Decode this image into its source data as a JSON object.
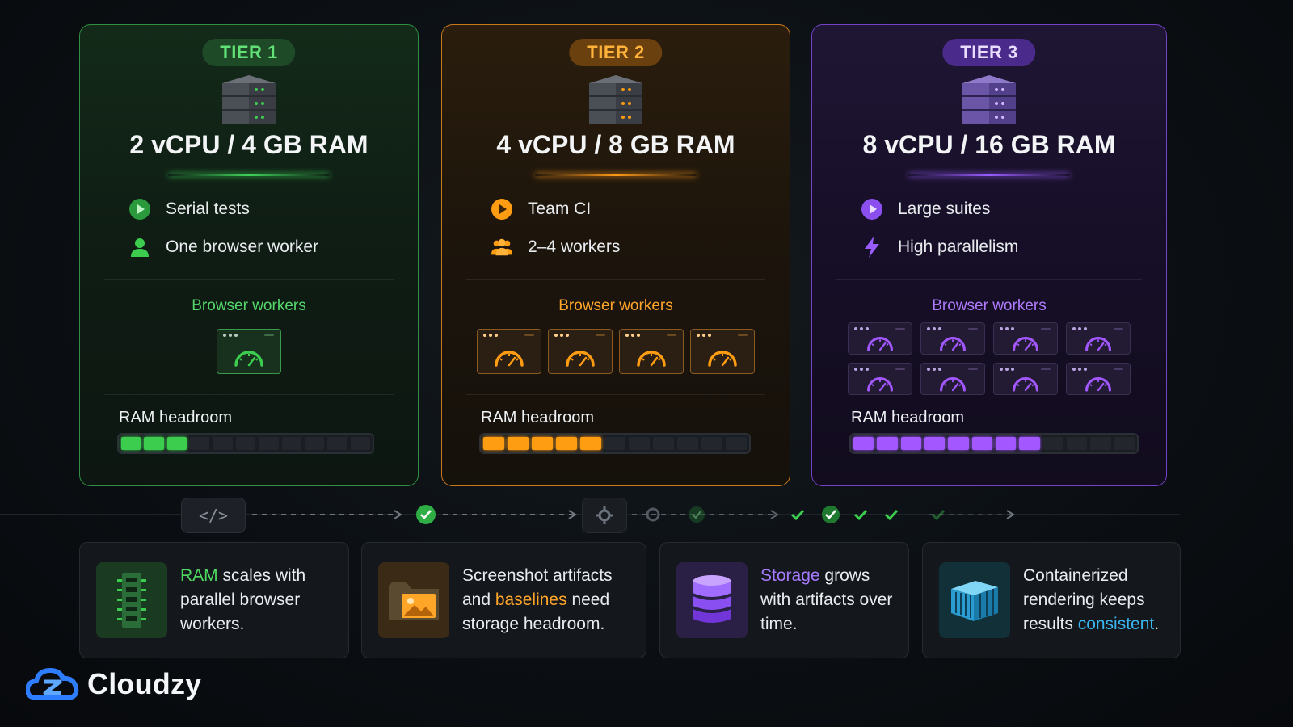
{
  "tiers": [
    {
      "badge": "TIER 1",
      "spec": "2 vCPU / 4 GB RAM",
      "features": [
        "Serial tests",
        "One browser worker"
      ],
      "workers_label": "Browser workers",
      "workers": 1,
      "ram_label": "RAM headroom",
      "ram_segments_filled": 3,
      "ram_segments_total": 11,
      "accent": "#3ccd4f"
    },
    {
      "badge": "TIER 2",
      "spec": "4 vCPU / 8 GB RAM",
      "features": [
        "Team CI",
        "2–4 workers"
      ],
      "workers_label": "Browser workers",
      "workers": 4,
      "ram_label": "RAM headroom",
      "ram_segments_filled": 5,
      "ram_segments_total": 11,
      "accent": "#ff9d12"
    },
    {
      "badge": "TIER 3",
      "spec": "8 vCPU / 16 GB RAM",
      "features": [
        "Large suites",
        "High parallelism"
      ],
      "workers_label": "Browser workers",
      "workers": 8,
      "ram_label": "RAM headroom",
      "ram_segments_filled": 8,
      "ram_segments_total": 12,
      "accent": "#a257ff"
    }
  ],
  "pipeline": {
    "code_symbol": "</>"
  },
  "info": [
    {
      "highlight": "RAM",
      "rest": " scales with parallel browser workers."
    },
    {
      "pre": "Screenshot artifacts and ",
      "highlight": "baselines",
      "post": " need storage headroom."
    },
    {
      "highlight": "Storage",
      "rest": " grows with artifacts over time."
    },
    {
      "pre": "Containerized rendering keeps results ",
      "highlight": "consistent",
      "post": "."
    }
  ],
  "brand": {
    "name": "Cloudzy"
  }
}
